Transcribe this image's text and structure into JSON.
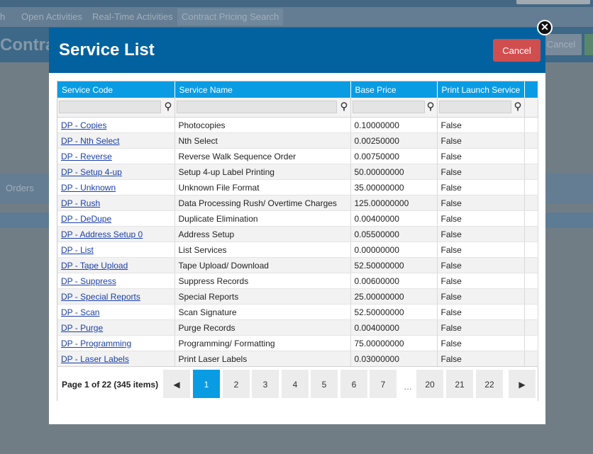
{
  "background": {
    "tabs": [
      "h",
      "Open Activities",
      "Real-Time Activities",
      "Contract Pricing Search"
    ],
    "header_title": "Contra",
    "cancel_label": "Cancel",
    "orders_label": "Orders"
  },
  "modal": {
    "title": "Service List",
    "cancel_label": "Cancel",
    "close_glyph": "✕"
  },
  "grid": {
    "columns": [
      "Service Code",
      "Service Name",
      "Base Price",
      "Print Launch Service"
    ],
    "rows": [
      {
        "code": "DP - Copies",
        "name": "Photocopies",
        "price": "0.10000000",
        "print": "False"
      },
      {
        "code": "DP - Nth Select",
        "name": "Nth Select",
        "price": "0.00250000",
        "print": "False"
      },
      {
        "code": "DP - Reverse",
        "name": "Reverse Walk Sequence Order",
        "price": "0.00750000",
        "print": "False"
      },
      {
        "code": "DP - Setup 4-up",
        "name": "Setup 4-up Label Printing",
        "price": "50.00000000",
        "print": "False"
      },
      {
        "code": "DP - Unknown",
        "name": "Unknown File Format",
        "price": "35.00000000",
        "print": "False"
      },
      {
        "code": "DP - Rush",
        "name": "Data Processing Rush/ Overtime Charges",
        "price": "125.00000000",
        "print": "False"
      },
      {
        "code": "DP - DeDupe",
        "name": "Duplicate Elimination",
        "price": "0.00400000",
        "print": "False"
      },
      {
        "code": "DP - Address Setup 0",
        "name": "Address Setup",
        "price": "0.05500000",
        "print": "False"
      },
      {
        "code": "DP - List",
        "name": "List Services",
        "price": "0.00000000",
        "print": "False"
      },
      {
        "code": "DP - Tape Upload",
        "name": "Tape Upload/ Download",
        "price": "52.50000000",
        "print": "False"
      },
      {
        "code": "DP - Suppress",
        "name": "Suppress Records",
        "price": "0.00600000",
        "print": "False"
      },
      {
        "code": "DP - Special Reports",
        "name": "Special Reports",
        "price": "25.00000000",
        "print": "False"
      },
      {
        "code": "DP - Scan",
        "name": "Scan Signature",
        "price": "52.50000000",
        "print": "False"
      },
      {
        "code": "DP - Purge",
        "name": "Purge Records",
        "price": "0.00400000",
        "print": "False"
      },
      {
        "code": "DP - Programming",
        "name": "Programming/ Formatting",
        "price": "75.00000000",
        "print": "False"
      },
      {
        "code": "DP - Laser Labels",
        "name": "Print Laser Labels",
        "price": "0.03000000",
        "print": "False"
      }
    ]
  },
  "pager": {
    "info": "Page 1 of 22 (345 items)",
    "pages": [
      "1",
      "2",
      "3",
      "4",
      "5",
      "6",
      "7",
      "20",
      "21",
      "22"
    ],
    "current": "1",
    "ellipsis": "…",
    "prev_glyph": "◀",
    "next_glyph": "▶"
  },
  "colors": {
    "header": "#01629f",
    "grid_header": "#0a9ce3",
    "cancel": "#d14e4e",
    "link": "#1b3fa8"
  }
}
